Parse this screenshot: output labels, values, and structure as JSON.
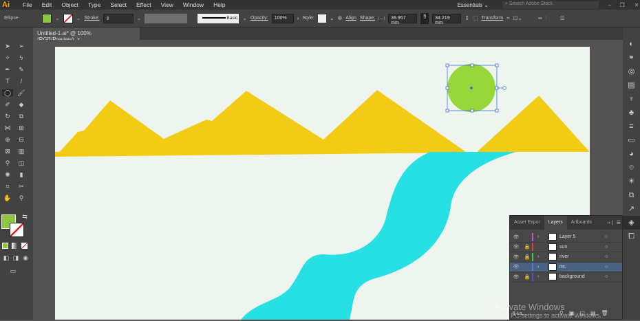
{
  "app": {
    "logo": "Ai",
    "menu": [
      "File",
      "Edit",
      "Object",
      "Type",
      "Select",
      "Effect",
      "View",
      "Window",
      "Help"
    ],
    "workspace": "Essentials",
    "search_placeholder": "Search Adobe Stock"
  },
  "control": {
    "selection": "Ellipse",
    "fill_color": "#8dc63f",
    "stroke_label": "Stroke:",
    "brush": "Basic",
    "opacity_label": "Opacity:",
    "opacity": "100%",
    "style_label": "Style:",
    "align": "Align",
    "shape_label": "Shape:",
    "width": "36.957 mm",
    "height": "34.219 mm",
    "transform": "Transform"
  },
  "document": {
    "tab": "Untitled-1.ai* @ 100% (RGB/Preview)",
    "close": "×"
  },
  "artwork": {
    "background": "#eef5ee",
    "mountain_color": "#f2cc14",
    "river_color": "#26e0e4",
    "sun_color": "#97d73a"
  },
  "layers_panel": {
    "tabs": [
      "Asset Expor",
      "Layers",
      "Artboards"
    ],
    "selected_tab": "Layers",
    "layers": [
      {
        "name": "Layer 5",
        "color": "#d24bd6",
        "locked": false,
        "expandable": true,
        "selected": false
      },
      {
        "name": "sun",
        "color": "#e23a3a",
        "locked": true,
        "expandable": false,
        "selected": false
      },
      {
        "name": "river",
        "color": "#3ecf4a",
        "locked": true,
        "expandable": true,
        "selected": false
      },
      {
        "name": "mt.",
        "color": "#4a7de0",
        "locked": false,
        "expandable": true,
        "selected": true
      },
      {
        "name": "background",
        "color": "#5b4ad6",
        "locked": true,
        "expandable": true,
        "selected": false
      }
    ],
    "footer": "5 La..."
  },
  "watermark": {
    "line1": "Activate Windows",
    "line2": "Go to PC settings to activate Windows."
  }
}
